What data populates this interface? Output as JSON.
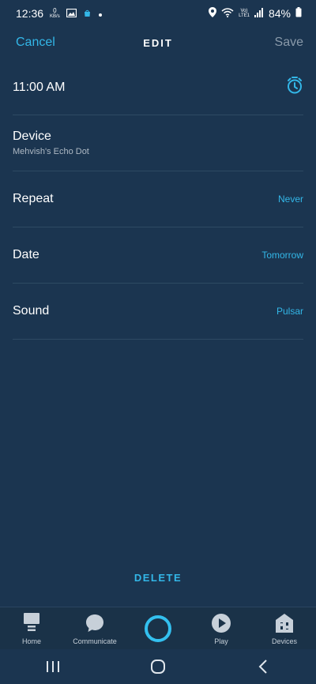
{
  "status_bar": {
    "time": "12:36",
    "kbs_top": "0",
    "kbs_bottom": "KB/s",
    "battery": "84%",
    "network_top": "Vo)",
    "network_bottom": "LTE1"
  },
  "header": {
    "cancel_label": "Cancel",
    "title": "EDIT",
    "save_label": "Save"
  },
  "alarm": {
    "time": "11:00 AM"
  },
  "rows": {
    "device_label": "Device",
    "device_value": "Mehvish's Echo Dot",
    "repeat_label": "Repeat",
    "repeat_value": "Never",
    "date_label": "Date",
    "date_value": "Tomorrow",
    "sound_label": "Sound",
    "sound_value": "Pulsar"
  },
  "delete_label": "DELETE",
  "bottom_nav": {
    "home": "Home",
    "communicate": "Communicate",
    "play": "Play",
    "devices": "Devices"
  },
  "colors": {
    "background": "#1b3550",
    "accent": "#33b7e8",
    "divider": "#2e4a63"
  }
}
